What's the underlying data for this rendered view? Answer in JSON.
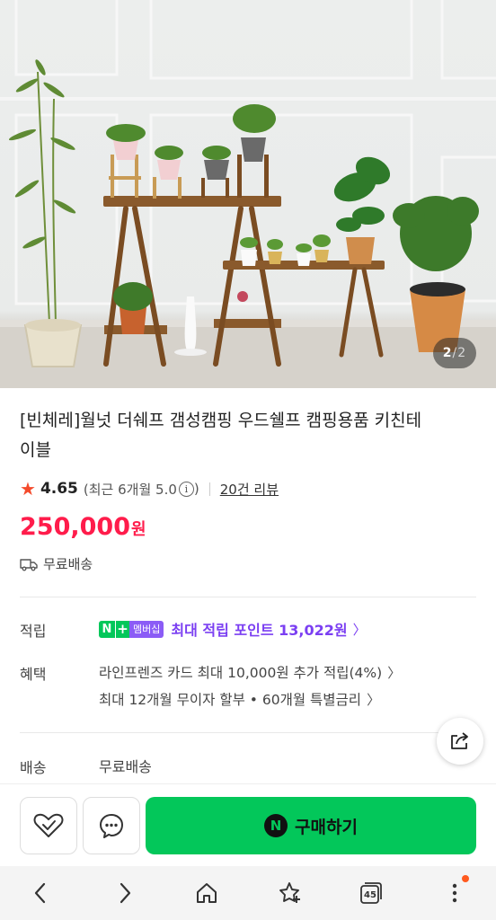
{
  "hero": {
    "counter_current": "2",
    "counter_sep": "/",
    "counter_total": "2"
  },
  "product": {
    "title": "[빈체레]월넛 더쉐프 갬성캠핑 우드쉘프 캠핑용품 키친테이블",
    "rating_score": "4.65",
    "rating_recent_prefix": "(최근 6개월 5.0",
    "rating_recent_suffix": ")",
    "reviews_label": "20건 리뷰",
    "price_number": "250,000",
    "price_unit": "원",
    "shipping_text": "무료배송"
  },
  "details": {
    "points_label": "적립",
    "npay_n": "N",
    "npay_plus": "+",
    "npay_membership": "멤버십",
    "points_text": "최대 적립 포인트 13,022원",
    "benefit_label": "혜택",
    "benefit_card": "라인프렌즈 카드 최대 10,000원 추가 적립(4%)",
    "benefit_installment": "최대 12개월 무이자 할부 • 60개월 특별금리",
    "delivery_label": "배송",
    "delivery_value": "무료배송"
  },
  "actions": {
    "buy_logo": "N",
    "buy_label": "구매하기"
  },
  "browser_nav": {
    "tabs_count": "45"
  },
  "colors": {
    "price_red": "#ff1c4b",
    "naver_green": "#03c75a",
    "points_purple": "#7b3ff2",
    "star": "#f44a2b",
    "notification_dot": "#ff5a1f"
  },
  "icons": [
    "star-icon",
    "info-icon",
    "truck-icon",
    "chevron-right-icon",
    "share-icon",
    "heart-check-icon",
    "chat-icon",
    "back-icon",
    "forward-icon",
    "home-icon",
    "bookmark-star-icon",
    "tabs-icon",
    "more-icon"
  ]
}
